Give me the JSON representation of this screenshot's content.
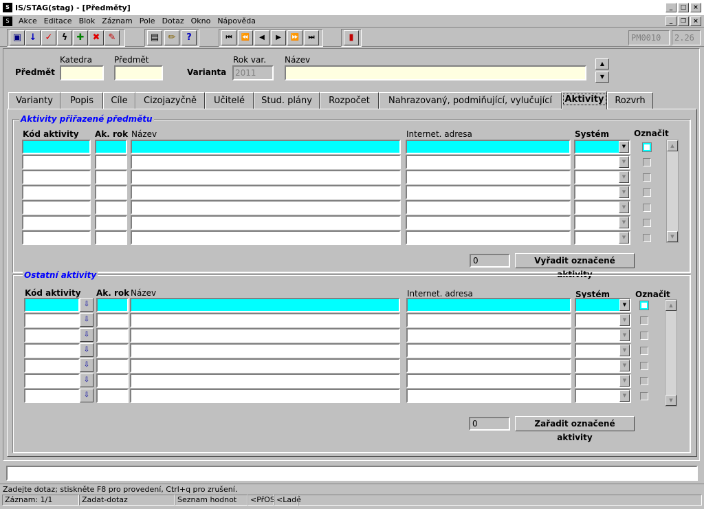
{
  "window": {
    "title": "IS/STAG(stag) - [Předměty]"
  },
  "menu": {
    "items": [
      "Akce",
      "Editace",
      "Blok",
      "Záznam",
      "Pole",
      "Dotaz",
      "Okno",
      "Nápověda"
    ]
  },
  "toolbar": {
    "form_code": "PM0010",
    "version": "2.26"
  },
  "header": {
    "predmet_label": "Předmět",
    "katedra_label": "Katedra",
    "predmet_col_label": "Předmět",
    "varianta_label": "Varianta",
    "rok_var_label": "Rok var.",
    "rok_var_value": "2011",
    "nazev_label": "Název"
  },
  "tabs": [
    "Varianty",
    "Popis",
    "Cíle",
    "Cizojazyčně",
    "Učitelé",
    "Stud. plány",
    "Rozpočet",
    "Nahrazovaný, podmiňující, vylučující",
    "Aktivity",
    "Rozvrh"
  ],
  "active_tab": "Aktivity",
  "assigned": {
    "title": "Aktivity přiřazené předmětu",
    "columns": {
      "kod": "Kód aktivity",
      "rok": "Ak. rok",
      "nazev": "Název",
      "adresa": "Internet. adresa",
      "system": "Systém",
      "oznacit": "Označit"
    },
    "count": "0",
    "button": "Vyřadit označené aktivity"
  },
  "other": {
    "title": "Ostatní aktivity",
    "columns": {
      "kod": "Kód aktivity",
      "rok": "Ak. rok",
      "nazev": "Název",
      "adresa": "Internet. adresa",
      "system": "Systém",
      "oznacit": "Označit"
    },
    "count": "0",
    "button": "Zařadit označené aktivity"
  },
  "status": {
    "message": "Zadejte dotaz; stiskněte F8 pro provedení, Ctrl+q  pro zrušení.",
    "record": "Záznam: 1/1",
    "mode": "Zadat-dotaz",
    "lov": "Seznam hodnot",
    "insert": "<PřOS",
    "debug": "<Ladě"
  }
}
